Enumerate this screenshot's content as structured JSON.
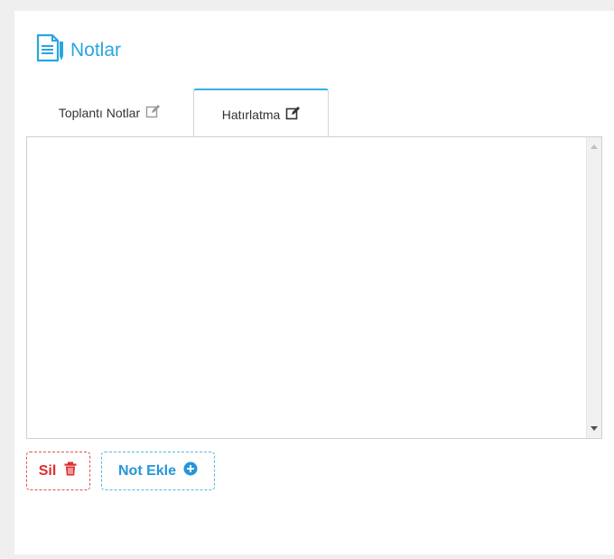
{
  "header": {
    "title": "Notlar",
    "icon": "notes-icon"
  },
  "tabs": [
    {
      "label": "Toplantı Notlar",
      "icon": "edit-icon",
      "active": false
    },
    {
      "label": "Hatırlatma",
      "icon": "edit-icon",
      "active": true
    }
  ],
  "editor": {
    "value": "",
    "placeholder": ""
  },
  "buttons": {
    "delete_label": "Sil",
    "delete_icon": "trash-icon",
    "add_label": "Not Ekle",
    "add_icon": "plus-circle-icon"
  },
  "colors": {
    "accent": "#28a6e0",
    "danger": "#e02d2d",
    "active_tab_border": "#35aee6"
  }
}
